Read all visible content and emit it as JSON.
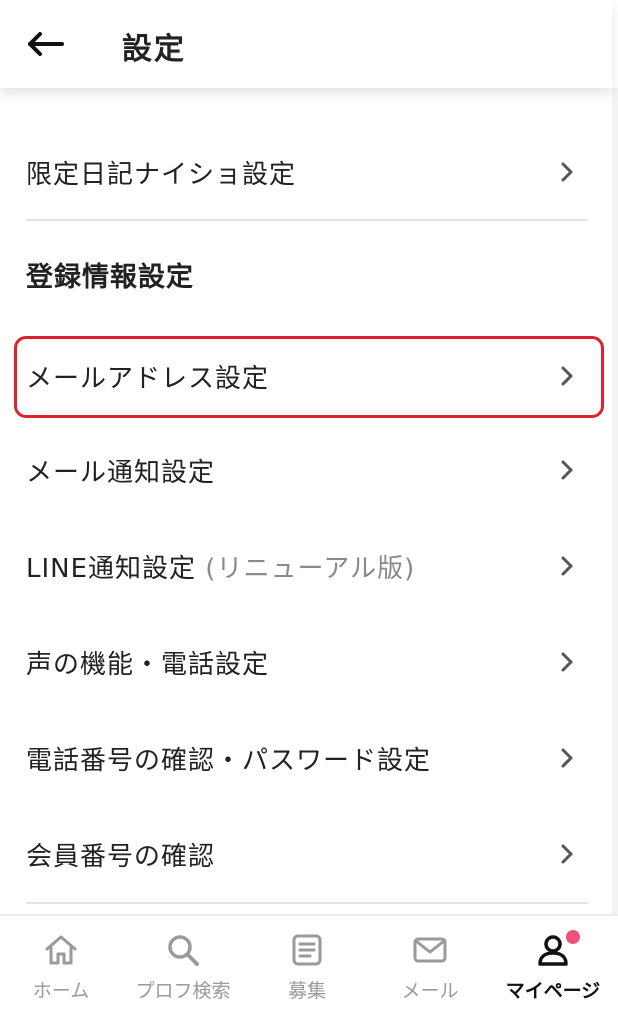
{
  "header": {
    "title": "設定",
    "back_icon": "arrow-left-icon"
  },
  "menu": {
    "secret_diary": {
      "label": "限定日記ナイショ設定"
    },
    "section_title": "登録情報設定",
    "items": [
      {
        "label": "メールアドレス設定",
        "suffix": ""
      },
      {
        "label": "メール通知設定",
        "suffix": ""
      },
      {
        "label": "LINE通知設定",
        "suffix": " (リニューアル版)"
      },
      {
        "label": "声の機能・電話設定",
        "suffix": ""
      },
      {
        "label": "電話番号の確認・パスワード設定",
        "suffix": ""
      },
      {
        "label": "会員番号の確認",
        "suffix": ""
      }
    ]
  },
  "tabbar": {
    "tabs": [
      {
        "label": "ホーム",
        "icon": "home-icon",
        "active": false
      },
      {
        "label": "プロフ検索",
        "icon": "search-icon",
        "active": false
      },
      {
        "label": "募集",
        "icon": "board-icon",
        "active": false
      },
      {
        "label": "メール",
        "icon": "mail-icon",
        "active": false
      },
      {
        "label": "マイページ",
        "icon": "user-icon",
        "active": true
      }
    ]
  },
  "colors": {
    "highlight": "#e0202d",
    "badge": "#f0517a",
    "inactive_tab": "#9a9a9a",
    "active_tab": "#111111"
  }
}
